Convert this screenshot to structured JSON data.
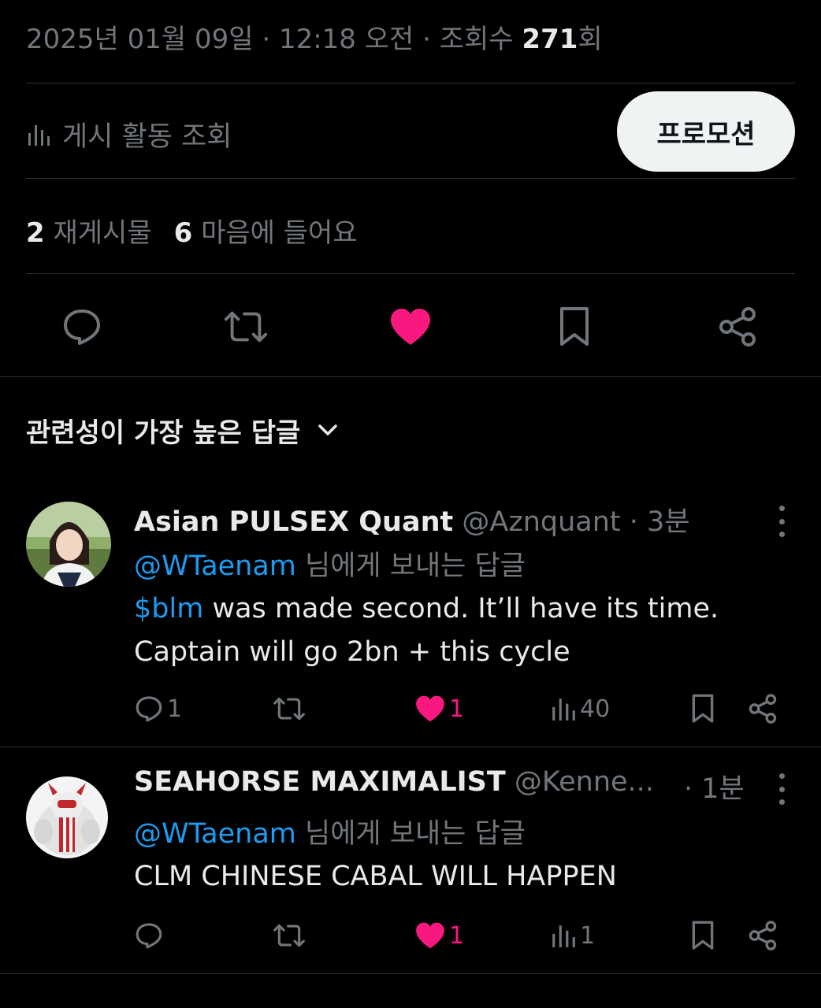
{
  "tweet_meta": {
    "date": "2025년 01월 09일",
    "sep1": " · ",
    "time": "12:18 오전",
    "sep2": " · ",
    "views_prefix": "조회수 ",
    "views_count": "271",
    "views_suffix": "회"
  },
  "activity": {
    "label": "게시 활동 조회",
    "icon": "bar-chart-icon"
  },
  "promote_button": "프로모션",
  "stats": {
    "reposts_count": "2",
    "reposts_label": "재게시물",
    "likes_count": "6",
    "likes_label": "마음에 들어요"
  },
  "sort_label": "관련성이 가장 높은 답글",
  "colors": {
    "background": "#000000",
    "text": "#e7e9ea",
    "muted": "#71767b",
    "link": "#1d9bf0",
    "like": "#f91880",
    "divider": "#2f3336"
  },
  "replies": [
    {
      "name": "Asian PULSEX Quant",
      "handle": "@Aznquant",
      "time": " · 3분",
      "replying_mention": "@WTaenam",
      "replying_suffix": " 님에게 보내는 답글",
      "text_cashtag": "$blm",
      "text_line1_rest": " was made second. It’ll have its time.",
      "text_line2": "Captain will go 2bn + this cycle",
      "reply_count": "1",
      "like_count": "1",
      "view_count": "40"
    },
    {
      "name": "SEAHORSE MAXIMALIST",
      "handle": "@Kenne...",
      "time": " · 1분",
      "replying_mention": "@WTaenam",
      "replying_suffix": " 님에게 보내는 답글",
      "text_line1": "CLM CHINESE CABAL WILL HAPPEN",
      "reply_count": "",
      "like_count": "1",
      "view_count": "1"
    }
  ]
}
